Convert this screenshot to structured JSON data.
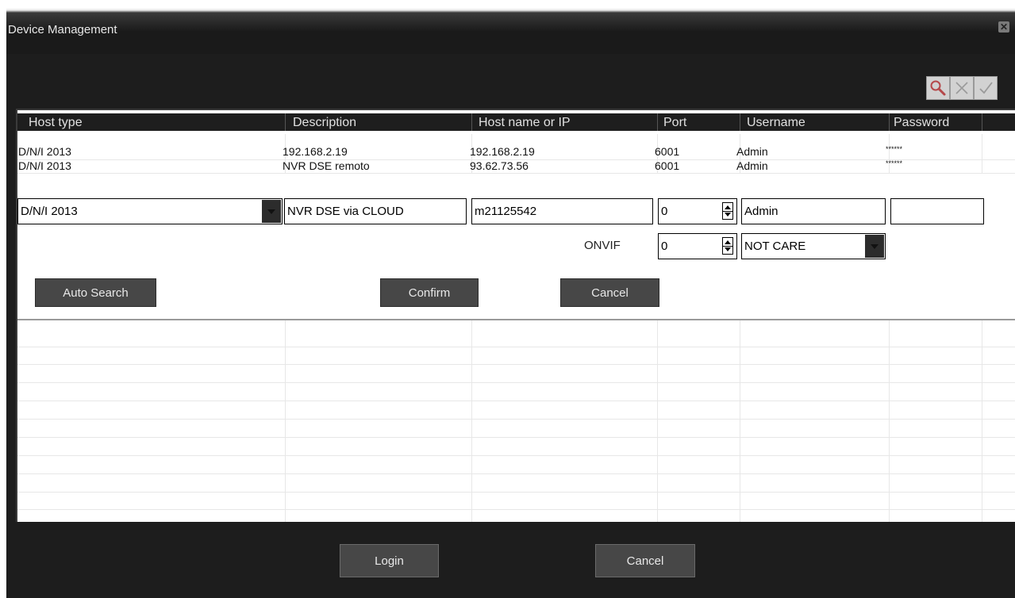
{
  "window": {
    "title": "Device Management",
    "close_icon": "close-icon"
  },
  "toolbar": {
    "icons": [
      "search-icon",
      "delete-icon",
      "check-icon"
    ]
  },
  "table": {
    "columns": [
      "Host type",
      "Description",
      "Host name or IP",
      "Port",
      "Username",
      "Password"
    ],
    "rows": [
      [
        "D/N/I 2013",
        "192.168.2.19",
        "192.168.2.19",
        "6001",
        "Admin",
        "******"
      ],
      [
        "D/N/I 2013",
        "NVR DSE remoto",
        "93.62.73.56",
        "6001",
        "Admin",
        "******"
      ]
    ]
  },
  "editor": {
    "host_type": "D/N/I 2013",
    "description": "NVR DSE via CLOUD",
    "host": "m21125542",
    "port": "0",
    "username": "Admin",
    "password": "",
    "onvif_label": "ONVIF",
    "onvif_port": "0",
    "onvif_mode": "NOT CARE",
    "auto_search_label": "Auto Search",
    "confirm_label": "Confirm",
    "cancel_label": "Cancel"
  },
  "footer": {
    "login_label": "Login",
    "cancel_label": "Cancel"
  }
}
